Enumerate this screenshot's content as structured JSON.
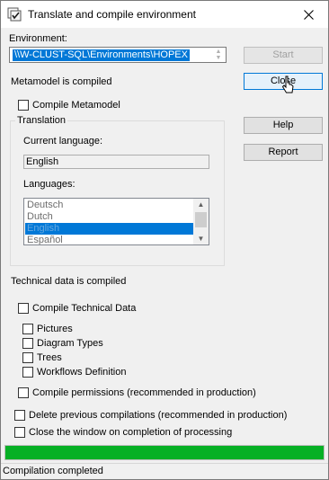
{
  "window": {
    "title": "Translate and compile environment",
    "close_glyph": "✕"
  },
  "environment": {
    "label": "Environment:",
    "value": "\\\\W-CLUST-SQL\\Environments\\HOPEX"
  },
  "metamodel": {
    "status": "Metamodel is compiled",
    "compile_label": "Compile Metamodel"
  },
  "translation": {
    "group_label": "Translation",
    "current_language_label": "Current language:",
    "current_language_value": "English",
    "languages_label": "Languages:",
    "languages": [
      "Deutsch",
      "Dutch",
      "English",
      "Español"
    ],
    "selected_language": "English"
  },
  "buttons": {
    "start": "Start",
    "close": "Close",
    "help": "Help",
    "report": "Report"
  },
  "technical": {
    "status": "Technical data is compiled",
    "compile_label": "Compile Technical Data",
    "items": [
      "Pictures",
      "Diagram Types",
      "Trees",
      "Workflows Definition"
    ]
  },
  "options": {
    "compile_permissions": "Compile permissions (recommended in production)",
    "delete_previous": "Delete previous compilations  (recommended in production)",
    "close_on_completion": "Close the window on completion of processing"
  },
  "progress": {
    "percent": 100,
    "color": "#06b025"
  },
  "status_bar": {
    "text": "Compilation completed"
  },
  "colors": {
    "selection": "#0078d7",
    "window_bg": "#f0f0f0"
  }
}
